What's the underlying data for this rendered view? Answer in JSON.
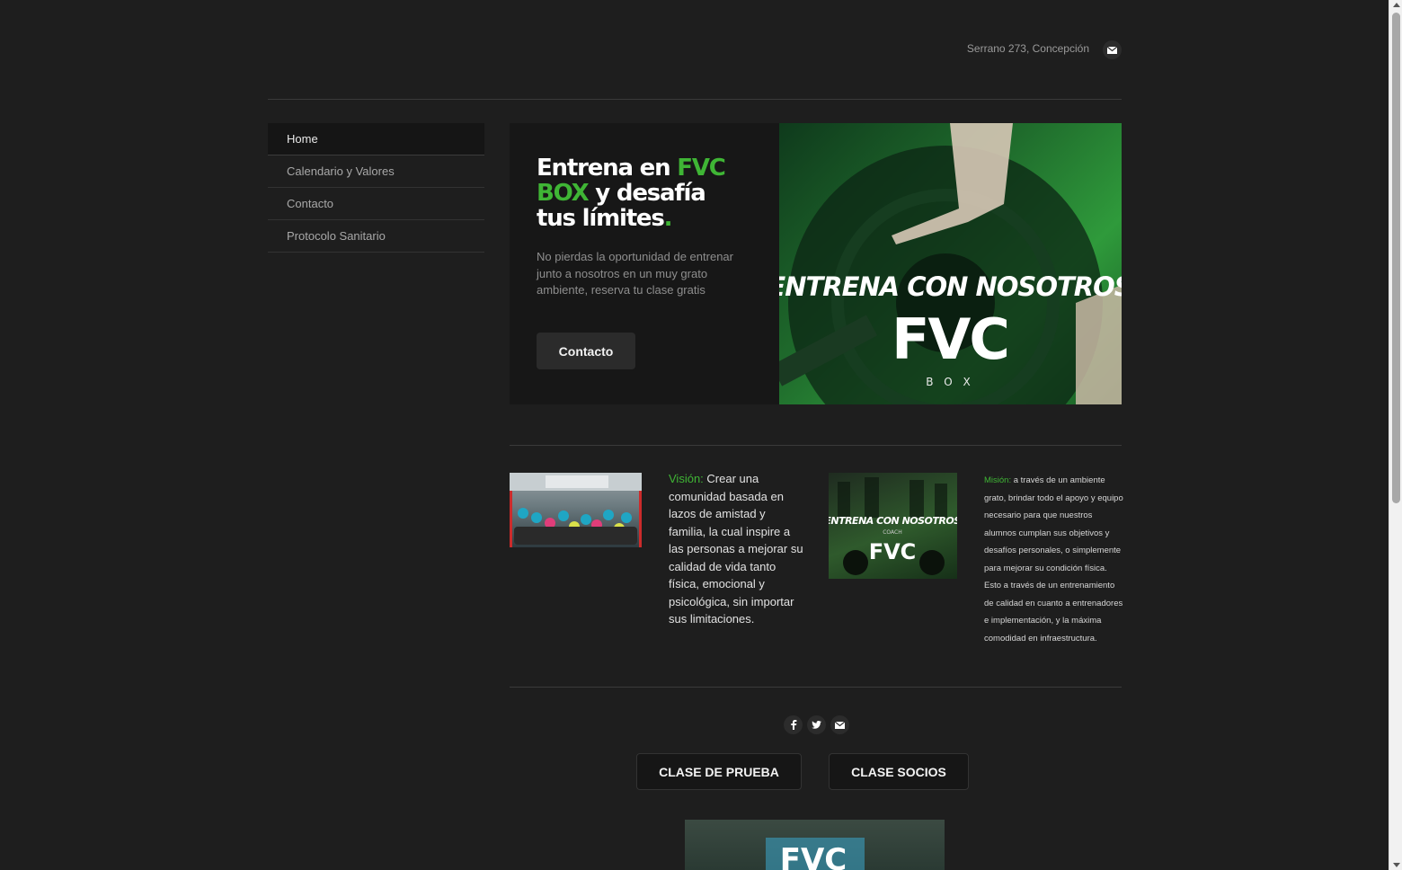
{
  "header": {
    "address": "Serrano 273, Concepción",
    "mail_icon": "mail-icon"
  },
  "nav": {
    "items": [
      {
        "label": "Home",
        "active": true
      },
      {
        "label": "Calendario y Valores",
        "active": false
      },
      {
        "label": "Contacto",
        "active": false
      },
      {
        "label": "Protocolo Sanitario",
        "active": false
      }
    ]
  },
  "hero": {
    "title_part1": "Entrena en ",
    "title_accent": "FVC BOX",
    "title_part2": " y desafía tus límites",
    "title_dot": ".",
    "subtitle": "No pierdas la oportunidad de entrenar junto a nosotros en un muy grato ambiente, reserva tu clase gratis",
    "button_label": "Contacto",
    "banner_line1": "ENTRENA CON NOSOTROS",
    "banner_logo": "FVC",
    "banner_sub": "B O X"
  },
  "vision": {
    "label": "Visión:",
    "text": " Crear una comunidad basada en lazos de amistad y familia, la cual inspire a las personas a mejorar su calidad de vida tanto física, emocional y psicológica, sin importar sus limitaciones."
  },
  "coach_image": {
    "line1": "ENTRENA CON NOSOTROS",
    "line2": "COACH",
    "logo": "FVC"
  },
  "mision": {
    "label": "Misión:",
    "text": " a través de un ambiente grato, brindar todo el apoyo y equipo necesario para que nuestros alumnos cumplan sus objetivos y desafíos personales, o simplemente para mejorar su condición física. Esto a través de un entrenamiento de calidad en cuanto a entrenadores e implementación, y la máxima comodidad en infraestructura."
  },
  "social": {
    "icons": [
      "facebook-icon",
      "twitter-icon",
      "mail-icon"
    ]
  },
  "cta": {
    "trial_label": "CLASE DE PRUEBA",
    "members_label": "CLASE SOCIOS"
  },
  "bottom_image": {
    "logo": "FVC"
  },
  "colors": {
    "background": "#1e1e1e",
    "accent_green": "#3fb535",
    "panel": "#171717"
  }
}
